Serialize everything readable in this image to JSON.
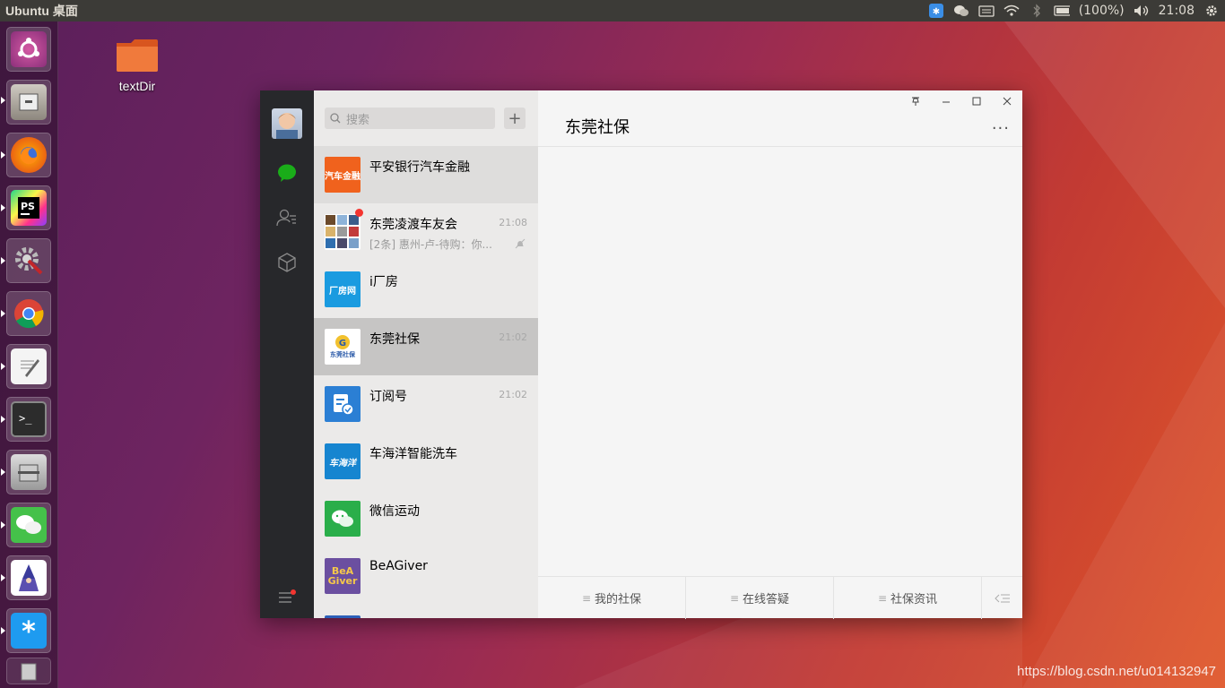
{
  "topbar": {
    "title": "Ubuntu 桌面",
    "battery": "(100%)",
    "time": "21:08"
  },
  "desktop": {
    "folder_label": "textDir"
  },
  "wechat": {
    "search_placeholder": "搜索",
    "add_label": "+",
    "chats": [
      {
        "name": "平安银行汽车金融",
        "time": "",
        "preview": "",
        "logo_text": "汽车金融",
        "logo_color": "#f0621d"
      },
      {
        "name": "东莞凌渡车友会",
        "time": "21:08",
        "preview": "[2条] 惠州-卢-待购：你...",
        "logo_text": "",
        "logo_color": "#ffffff"
      },
      {
        "name": "i厂房",
        "time": "",
        "preview": "",
        "logo_text": "厂房网",
        "logo_color": "#1a9be0"
      },
      {
        "name": "东莞社保",
        "time": "21:02",
        "preview": "",
        "logo_text": "东莞社保",
        "logo_color": "#ffffff"
      },
      {
        "name": "订阅号",
        "time": "21:02",
        "preview": "",
        "logo_text": "",
        "logo_color": "#2b7fd4"
      },
      {
        "name": "车海洋智能洗车",
        "time": "",
        "preview": "",
        "logo_text": "车海洋",
        "logo_color": "#1685d0"
      },
      {
        "name": "微信运动",
        "time": "",
        "preview": "",
        "logo_text": "",
        "logo_color": "#2aae4a"
      },
      {
        "name": "BeAGiver",
        "time": "",
        "preview": "",
        "logo_text": "BeA Giver",
        "logo_color": "#6b4fa0"
      }
    ],
    "chat_title": "东莞社保",
    "more": "···",
    "menu": [
      "我的社保",
      "在线答疑",
      "社保资讯"
    ]
  },
  "watermark": "https://blog.csdn.net/u014132947",
  "colors": {
    "accent_green": "#1aad19",
    "unread_red": "#f43530"
  }
}
